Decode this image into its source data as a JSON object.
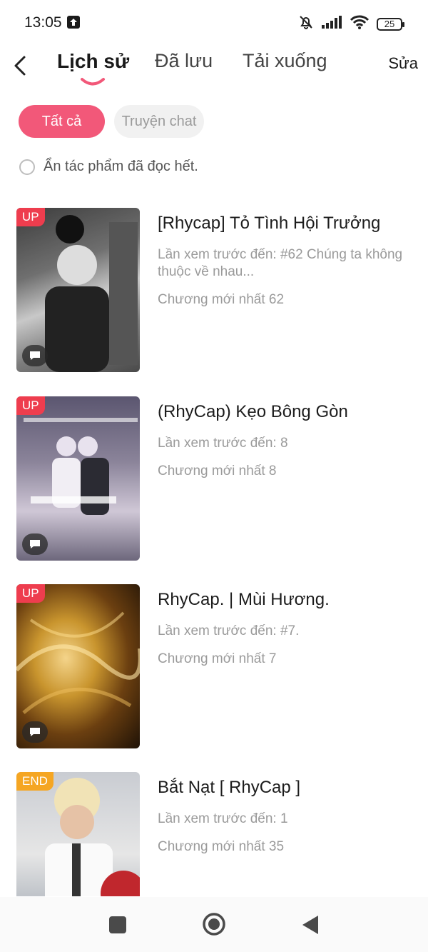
{
  "status": {
    "time": "13:05",
    "battery": "25"
  },
  "header": {
    "tabs": [
      {
        "label": "Lịch sử",
        "active": true
      },
      {
        "label": "Đã lưu",
        "active": false
      },
      {
        "label": "Tải xuống",
        "active": false
      }
    ],
    "edit_label": "Sửa"
  },
  "filters": [
    {
      "label": "Tất cả",
      "selected": true
    },
    {
      "label": "Truyện chat",
      "selected": false
    }
  ],
  "hide_read_label": "Ẩn tác phẩm đã đọc hết.",
  "stories": [
    {
      "badge": "UP",
      "title": "[Rhycap] Tỏ Tình Hội Trưởng",
      "progress": "Lần xem trước đến: #62 Chúng ta không thuộc về nhau...",
      "latest": "Chương mới nhất 62"
    },
    {
      "badge": "UP",
      "title": "(RhyCap) Kẹo Bông Gòn",
      "progress": "Lần xem trước đến: 8",
      "latest": "Chương mới nhất 8"
    },
    {
      "badge": "UP",
      "title": "RhyCap. | Mùi Hương.",
      "progress": "Lần xem trước đến: #7.",
      "latest": "Chương mới nhất 7"
    },
    {
      "badge": "END",
      "title": "Bắt Nạt [ RhyCap ]",
      "progress": "Lần xem trước đến: 1",
      "latest": "Chương mới nhất 35"
    }
  ],
  "theme": {
    "accent": "#f25879",
    "up_badge": "#ee3d4e",
    "end_badge": "#f5a623"
  }
}
